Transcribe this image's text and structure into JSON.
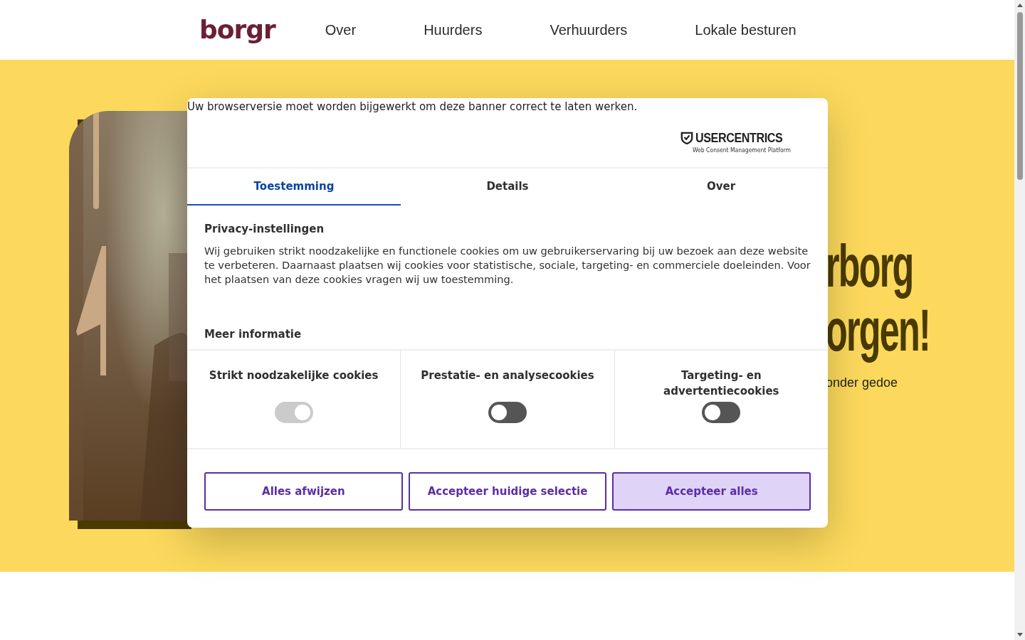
{
  "header": {
    "logo": "borgr",
    "nav": [
      {
        "label": "Over"
      },
      {
        "label": "Huurders"
      },
      {
        "label": "Verhuurders"
      },
      {
        "label": "Lokale besturen"
      }
    ]
  },
  "hero": {
    "picture": {
      "kind": "picture"
    },
    "heading_lines": [
      "rborg",
      "orgen!"
    ],
    "subtitle": "onder gedoe"
  },
  "consent_banner": {
    "browser_notice": "Uw browserversie moet worden bijgewerkt om deze banner correct te laten werken.",
    "provider": {
      "name": "USERCENTRICS",
      "tagline": "Web Consent Management Platform"
    },
    "tabs": [
      {
        "label": "Toestemming",
        "selected": true
      },
      {
        "label": "Details",
        "selected": false
      },
      {
        "label": "Over",
        "selected": false
      }
    ],
    "title": "Privacy-instellingen",
    "description": "Wij gebruiken strikt noodzakelijke en functionele cookies om uw gebruikerservaring bij uw bezoek aan deze website te verbeteren. Daarnaast plaatsen wij cookies voor statistische, sociale, targeting- en commerciele doeleinden. Voor het plaatsen van deze cookies vragen wij uw toestemming.",
    "more_info": "Meer informatie",
    "categories": [
      {
        "label": "Strikt noodzakelijke cookies",
        "on": true,
        "disabled": true
      },
      {
        "label": "Prestatie- en analysecookies",
        "on": false,
        "disabled": false
      },
      {
        "label": "Targeting- en advertentiecookies",
        "on": false,
        "disabled": false
      }
    ],
    "buttons": [
      {
        "label": "Alles afwijzen",
        "primary": false
      },
      {
        "label": "Accepteer huidige selectie",
        "primary": false
      },
      {
        "label": "Accepteer alles",
        "primary": true
      }
    ]
  }
}
